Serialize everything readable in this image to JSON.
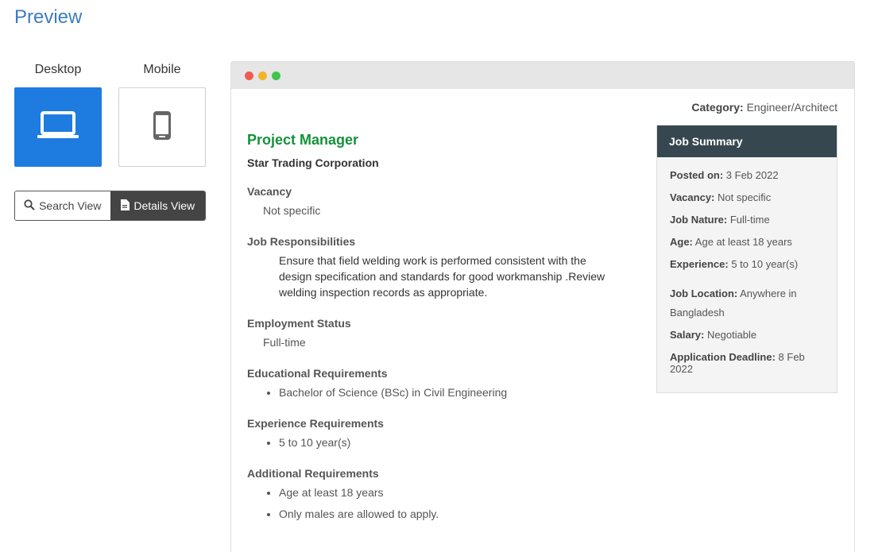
{
  "page_title": "Preview",
  "device": {
    "desktop_label": "Desktop",
    "mobile_label": "Mobile",
    "active": "desktop"
  },
  "view_toggle": {
    "search_label": "Search View",
    "details_label": "Details View",
    "active": "details"
  },
  "colors": {
    "accent": "#1e7be0",
    "title": "#3a7cc0",
    "job_title": "#14913a",
    "summary_header": "#37474f"
  },
  "job": {
    "category_label": "Category:",
    "category_value": "Engineer/Architect",
    "title": "Project Manager",
    "company": "Star Trading Corporation",
    "vacancy_heading": "Vacancy",
    "vacancy_value": "Not specific",
    "responsibilities_heading": "Job Responsibilities",
    "responsibilities_text": "Ensure that field welding work is performed consistent with the design specification and standards for good workmanship .Review welding inspection records as appropriate.",
    "employment_heading": "Employment Status",
    "employment_value": "Full-time",
    "education_heading": "Educational Requirements",
    "education_items": [
      "Bachelor of Science (BSc) in Civil Engineering"
    ],
    "experience_heading": "Experience Requirements",
    "experience_items": [
      "5 to 10 year(s)"
    ],
    "additional_heading": "Additional Requirements",
    "additional_items": [
      "Age at least 18 years",
      "Only males are allowed to apply."
    ]
  },
  "summary": {
    "heading": "Job Summary",
    "rows": [
      {
        "label": "Posted on:",
        "value": "3 Feb 2022"
      },
      {
        "label": "Vacancy:",
        "value": "Not specific"
      },
      {
        "label": "Job Nature:",
        "value": "Full-time"
      },
      {
        "label": "Age:",
        "value": "Age at least 18 years"
      },
      {
        "label": "Experience:",
        "value": "5 to 10 year(s)"
      },
      {
        "label": "Job Location:",
        "value": "Anywhere in Bangladesh"
      },
      {
        "label": "Salary:",
        "value": "Negotiable"
      },
      {
        "label": "Application Deadline:",
        "value": "8 Feb 2022"
      }
    ]
  },
  "icons": {
    "desktop": "laptop-icon",
    "mobile": "smartphone-icon",
    "search": "search-icon",
    "details": "document-icon"
  }
}
